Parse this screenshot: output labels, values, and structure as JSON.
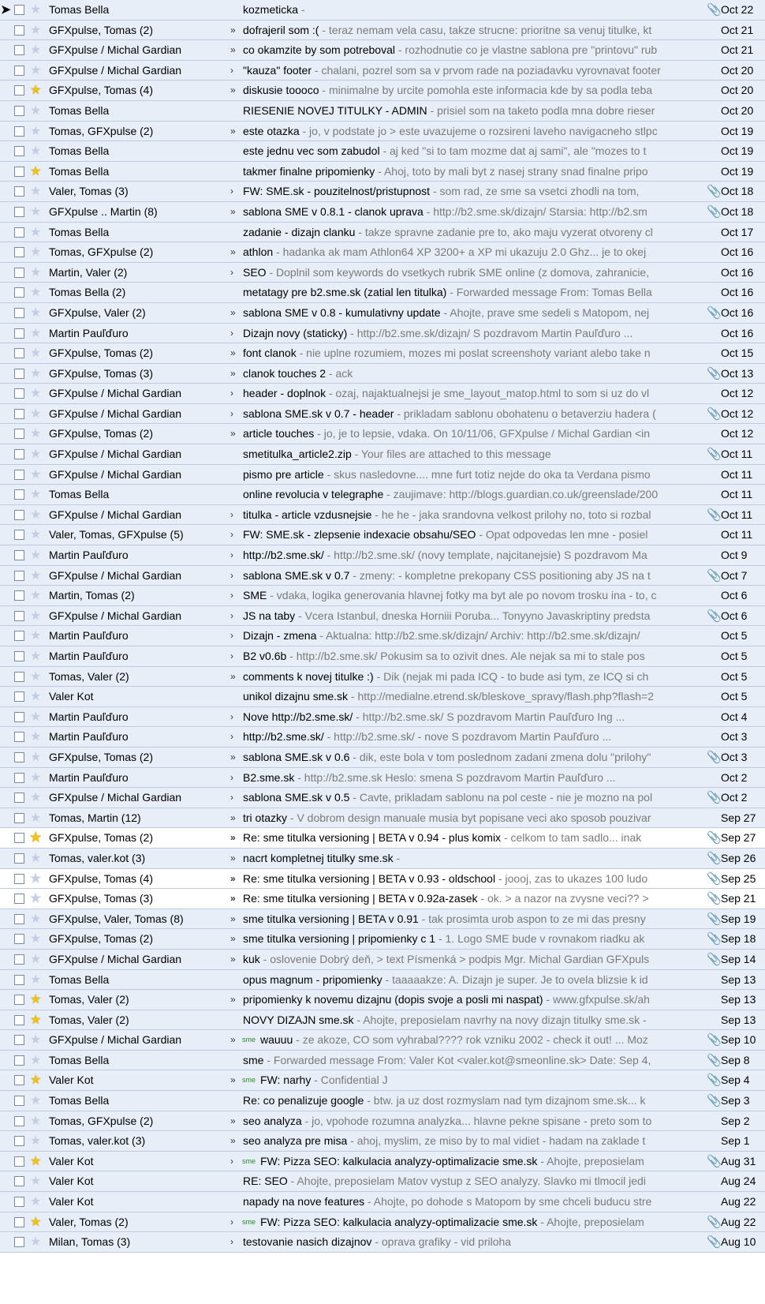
{
  "emails": [
    {
      "sender": "Tomas Bella",
      "subject": "kozmeticka",
      "snippet": " - ",
      "date": "Oct 22",
      "starred": false,
      "attachment": true,
      "imp": "",
      "pointer": true
    },
    {
      "sender": "GFXpulse, Tomas (2)",
      "subject": "dofrajeril som :(",
      "snippet": " - teraz nemam vela casu, takze strucne: prioritne sa venuj titulke, kt",
      "date": "Oct 21",
      "starred": false,
      "attachment": false,
      "imp": "»"
    },
    {
      "sender": "GFXpulse / Michal Gardian",
      "subject": "co okamzite by som potreboval",
      "snippet": " - rozhodnutie co je vlastne sablona pre \"printovu\" rub",
      "date": "Oct 21",
      "starred": false,
      "attachment": false,
      "imp": "»"
    },
    {
      "sender": "GFXpulse / Michal Gardian",
      "subject": "\"kauza\" footer",
      "snippet": " - chalani, pozrel som sa v prvom rade na poziadavku vyrovnavat footer",
      "date": "Oct 20",
      "starred": false,
      "attachment": false,
      "imp": "›"
    },
    {
      "sender": "GFXpulse, Tomas (4)",
      "subject": "diskusie toooco",
      "snippet": " - minimalne by urcite pomohla este informacia kde by sa podla teba",
      "date": "Oct 20",
      "starred": true,
      "attachment": false,
      "imp": "»"
    },
    {
      "sender": "Tomas Bella",
      "subject": "RIESENIE NOVEJ TITULKY - ADMIN",
      "snippet": " - prisiel som na taketo podla mna dobre rieser",
      "date": "Oct 20",
      "starred": false,
      "attachment": false,
      "imp": ""
    },
    {
      "sender": "Tomas, GFXpulse (2)",
      "subject": "este otazka",
      "snippet": " - jo, v podstate jo > este uvazujeme o rozsireni laveho navigacneho stlpc",
      "date": "Oct 19",
      "starred": false,
      "attachment": false,
      "imp": "»"
    },
    {
      "sender": "Tomas Bella",
      "subject": "este jednu vec som zabudol",
      "snippet": " - aj ked \"si to tam mozme dat aj sami\", ale \"mozes to t",
      "date": "Oct 19",
      "starred": false,
      "attachment": false,
      "imp": ""
    },
    {
      "sender": "Tomas Bella",
      "subject": "takmer finalne pripomienky",
      "snippet": " - Ahoj, toto by mali byt z nasej strany snad finalne pripo",
      "date": "Oct 19",
      "starred": true,
      "attachment": false,
      "imp": ""
    },
    {
      "sender": "Valer, Tomas (3)",
      "subject": "FW: SME.sk - pouzitelnost/pristupnost",
      "snippet": " - som rad, ze sme sa vsetci zhodli na tom,",
      "date": "Oct 18",
      "starred": false,
      "attachment": true,
      "imp": "›"
    },
    {
      "sender": "GFXpulse .. Martin (8)",
      "subject": "sablona SME v 0.8.1 - clanok uprava",
      "snippet": " - http://b2.sme.sk/dizajn/ Starsia: http://b2.sm",
      "date": "Oct 18",
      "starred": false,
      "attachment": true,
      "imp": "»"
    },
    {
      "sender": "Tomas Bella",
      "subject": "zadanie - dizajn clanku",
      "snippet": " - takze spravne zadanie pre to, ako maju vyzerat otvoreny cl",
      "date": "Oct 17",
      "starred": false,
      "attachment": false,
      "imp": ""
    },
    {
      "sender": "Tomas, GFXpulse (2)",
      "subject": "athlon",
      "snippet": " - hadanka ak mam Athlon64 XP 3200+ a XP mi ukazuju 2.0 Ghz... je to okej",
      "date": "Oct 16",
      "starred": false,
      "attachment": false,
      "imp": "»"
    },
    {
      "sender": "Martin, Valer (2)",
      "subject": "SEO",
      "snippet": " - Doplnil som keywords do vsetkych rubrik SME online (z domova, zahranicie,",
      "date": "Oct 16",
      "starred": false,
      "attachment": false,
      "imp": "›"
    },
    {
      "sender": "Tomas Bella (2)",
      "subject": "metatagy pre b2.sme.sk (zatial len titulka)",
      "snippet": " - Forwarded message From: Tomas Bella",
      "date": "Oct 16",
      "starred": false,
      "attachment": false,
      "imp": ""
    },
    {
      "sender": "GFXpulse, Valer (2)",
      "subject": "sablona SME v 0.8 - kumulativny update",
      "snippet": " - Ahojte, prave sme sedeli s Matopom, nej",
      "date": "Oct 16",
      "starred": false,
      "attachment": true,
      "imp": "»"
    },
    {
      "sender": "Martin Pauľďuro",
      "subject": "Dizajn novy (staticky)",
      "snippet": " - http://b2.sme.sk/dizajn/ S pozdravom Martin Pauľďuro ...",
      "date": "Oct 16",
      "starred": false,
      "attachment": false,
      "imp": "›"
    },
    {
      "sender": "GFXpulse, Tomas (2)",
      "subject": "font clanok",
      "snippet": " - nie uplne rozumiem, mozes mi poslat screenshoty variant alebo take n",
      "date": "Oct 15",
      "starred": false,
      "attachment": false,
      "imp": "»"
    },
    {
      "sender": "GFXpulse, Tomas (3)",
      "subject": "clanok touches 2",
      "snippet": " - ack",
      "date": "Oct 13",
      "starred": false,
      "attachment": true,
      "imp": "»"
    },
    {
      "sender": "GFXpulse / Michal Gardian",
      "subject": "header - doplnok",
      "snippet": " - ozaj, najaktualnejsi je sme_layout_matop.html to som si uz do vl",
      "date": "Oct 12",
      "starred": false,
      "attachment": false,
      "imp": "›"
    },
    {
      "sender": "GFXpulse / Michal Gardian",
      "subject": "sablona SME.sk v 0.7 - header",
      "snippet": " - prikladam sablonu obohatenu o betaverziu hadera (",
      "date": "Oct 12",
      "starred": false,
      "attachment": true,
      "imp": "›"
    },
    {
      "sender": "GFXpulse, Tomas (2)",
      "subject": "article touches",
      "snippet": " - jo, je to lepsie, vdaka. On 10/11/06, GFXpulse / Michal Gardian <in",
      "date": "Oct 12",
      "starred": false,
      "attachment": false,
      "imp": "»"
    },
    {
      "sender": "GFXpulse / Michal Gardian",
      "subject": "smetitulka_article2.zip",
      "snippet": " - Your files are attached to this message",
      "date": "Oct 11",
      "starred": false,
      "attachment": true,
      "imp": ""
    },
    {
      "sender": "GFXpulse / Michal Gardian",
      "subject": "pismo pre article",
      "snippet": " - skus nasledovne.... mne furt totiz nejde do oka ta Verdana pismo",
      "date": "Oct 11",
      "starred": false,
      "attachment": false,
      "imp": ""
    },
    {
      "sender": "Tomas Bella",
      "subject": "online revolucia v telegraphe",
      "snippet": " - zaujimave: http://blogs.guardian.co.uk/greenslade/200",
      "date": "Oct 11",
      "starred": false,
      "attachment": false,
      "imp": ""
    },
    {
      "sender": "GFXpulse / Michal Gardian",
      "subject": "titulka - article vzdusnejsie",
      "snippet": " - he he - jaka srandovna velkost prilohy no, toto si rozbal",
      "date": "Oct 11",
      "starred": false,
      "attachment": true,
      "imp": "›"
    },
    {
      "sender": "Valer, Tomas, GFXpulse (5)",
      "subject": "FW: SME.sk - zlepsenie indexacie obsahu/SEO",
      "snippet": " - Opat odpovedas len mne - posiel",
      "date": "Oct 11",
      "starred": false,
      "attachment": false,
      "imp": "›"
    },
    {
      "sender": "Martin Pauľďuro",
      "subject": "http://b2.sme.sk/",
      "snippet": " - http://b2.sme.sk/ (novy template, najcitanejsie) S pozdravom Ma",
      "date": "Oct 9",
      "starred": false,
      "attachment": false,
      "imp": "›"
    },
    {
      "sender": "GFXpulse / Michal Gardian",
      "subject": "sablona SME.sk v 0.7",
      "snippet": " - zmeny: - kompletne prekopany CSS positioning aby JS na t",
      "date": "Oct 7",
      "starred": false,
      "attachment": true,
      "imp": "›"
    },
    {
      "sender": "Martin, Tomas (2)",
      "subject": "SME",
      "snippet": " - vdaka, logika generovania hlavnej fotky ma byt ale po novom trosku ina - to, c",
      "date": "Oct 6",
      "starred": false,
      "attachment": false,
      "imp": "›"
    },
    {
      "sender": "GFXpulse / Michal Gardian",
      "subject": "JS na taby",
      "snippet": " - Vcera Istanbul, dneska Horniii Poruba... Tonyyno Javaskriptiny predsta",
      "date": "Oct 6",
      "starred": false,
      "attachment": true,
      "imp": "›"
    },
    {
      "sender": "Martin Pauľďuro",
      "subject": "Dizajn - zmena",
      "snippet": " - Aktualna: http://b2.sme.sk/dizajn/ Archiv: http://b2.sme.sk/dizajn/",
      "date": "Oct 5",
      "starred": false,
      "attachment": false,
      "imp": "›"
    },
    {
      "sender": "Martin Pauľďuro",
      "subject": "B2 v0.6b",
      "snippet": " - http://b2.sme.sk/ Pokusim sa to ozivit dnes. Ale nejak sa mi to stale pos",
      "date": "Oct 5",
      "starred": false,
      "attachment": false,
      "imp": "›"
    },
    {
      "sender": "Tomas, Valer (2)",
      "subject": "comments k novej titulke :)",
      "snippet": " - Dik (nejak mi pada ICQ - to bude asi tym, ze ICQ si ch",
      "date": "Oct 5",
      "starred": false,
      "attachment": false,
      "imp": "»"
    },
    {
      "sender": "Valer Kot",
      "subject": "unikol dizajnu sme.sk",
      "snippet": " - http://medialne.etrend.sk/bleskove_spravy/flash.php?flash=2",
      "date": "Oct 5",
      "starred": false,
      "attachment": false,
      "imp": ""
    },
    {
      "sender": "Martin Pauľďuro",
      "subject": "Nove http://b2.sme.sk/",
      "snippet": " - http://b2.sme.sk/ S pozdravom Martin Pauľďuro Ing ...",
      "date": "Oct 4",
      "starred": false,
      "attachment": false,
      "imp": "›"
    },
    {
      "sender": "Martin Pauľďuro",
      "subject": "http://b2.sme.sk/",
      "snippet": " - http://b2.sme.sk/ - nove S pozdravom Martin Pauľďuro ...",
      "date": "Oct 3",
      "starred": false,
      "attachment": false,
      "imp": "›"
    },
    {
      "sender": "GFXpulse, Tomas (2)",
      "subject": "sablona SME.sk v 0.6",
      "snippet": " - dik, este bola v tom poslednom zadani zmena dolu \"prilohy\"",
      "date": "Oct 3",
      "starred": false,
      "attachment": true,
      "imp": "»"
    },
    {
      "sender": "Martin Pauľďuro",
      "subject": "B2.sme.sk",
      "snippet": " - http://b2.sme.sk Heslo: smena S pozdravom Martin Pauľďuro ...",
      "date": "Oct 2",
      "starred": false,
      "attachment": false,
      "imp": "›"
    },
    {
      "sender": "GFXpulse / Michal Gardian",
      "subject": "sablona SME.sk v 0.5",
      "snippet": " - Cavte, prikladam sablonu na pol ceste - nie je mozno na pol",
      "date": "Oct 2",
      "starred": false,
      "attachment": true,
      "imp": "›"
    },
    {
      "sender": "Tomas, Martin (12)",
      "subject": "tri otazky",
      "snippet": " - V dobrom design manuale musia byt popisane veci ako sposob pouzivar",
      "date": "Sep 27",
      "starred": false,
      "attachment": false,
      "imp": "»"
    },
    {
      "sender": "GFXpulse, Tomas (2)",
      "subject": "Re: sme titulka versioning | BETA v 0.94 - plus komix",
      "snippet": " - celkom to tam sadlo... inak",
      "date": "Sep 27",
      "starred": true,
      "attachment": true,
      "imp": "»",
      "unread": true
    },
    {
      "sender": "Tomas, valer.kot (3)",
      "subject": "nacrt kompletnej titulky sme.sk",
      "snippet": " - ",
      "date": "Sep 26",
      "starred": false,
      "attachment": true,
      "imp": "»"
    },
    {
      "sender": "GFXpulse, Tomas (4)",
      "subject": "Re: sme titulka versioning | BETA v 0.93 - oldschool",
      "snippet": " - joooj, zas to ukazes 100 ludo",
      "date": "Sep 25",
      "starred": false,
      "attachment": true,
      "imp": "»",
      "unread": true
    },
    {
      "sender": "GFXpulse, Tomas (3)",
      "subject": "Re: sme titulka versioning | BETA v 0.92a-zasek",
      "snippet": " - ok. > a nazor na zvysne veci?? >",
      "date": "Sep 21",
      "starred": false,
      "attachment": true,
      "imp": "»",
      "unread": true
    },
    {
      "sender": "GFXpulse, Valer, Tomas (8)",
      "subject": "sme titulka versioning | BETA v 0.91",
      "snippet": " - tak prosimta urob aspon to ze mi das presny",
      "date": "Sep 19",
      "starred": false,
      "attachment": true,
      "imp": "»"
    },
    {
      "sender": "GFXpulse, Tomas (2)",
      "subject": "sme titulka versioning | pripomienky c 1",
      "snippet": " - 1. Logo SME bude v rovnakom riadku ak",
      "date": "Sep 18",
      "starred": false,
      "attachment": true,
      "imp": "»"
    },
    {
      "sender": "GFXpulse / Michal Gardian",
      "subject": "kuk",
      "snippet": " - oslovenie Dobrý deň, > text Písmenká > podpis Mgr. Michal Gardian GFXpuls",
      "date": "Sep 14",
      "starred": false,
      "attachment": true,
      "imp": "»"
    },
    {
      "sender": "Tomas Bella",
      "subject": "opus magnum - pripomienky",
      "snippet": " - taaaaakze: A. Dizajn je super. Je to ovela blizsie k id",
      "date": "Sep 13",
      "starred": false,
      "attachment": false,
      "imp": ""
    },
    {
      "sender": "Tomas, Valer (2)",
      "subject": "pripomienky k novemu dizajnu (dopis svoje a posli mi naspat)",
      "snippet": " - www.gfxpulse.sk/ah",
      "date": "Sep 13",
      "starred": true,
      "attachment": false,
      "imp": "»"
    },
    {
      "sender": "Tomas, Valer (2)",
      "subject": "NOVY DIZAJN sme.sk",
      "snippet": " - Ahojte, preposielam navrhy na novy dizajn titulky sme.sk -",
      "date": "Sep 13",
      "starred": true,
      "attachment": false,
      "imp": ""
    },
    {
      "sender": "GFXpulse / Michal Gardian",
      "subject": "wauuu",
      "snippet": " - ze akoze, CO som vyhrabal???? rok vzniku 2002 - check it out! ... Moz",
      "date": "Sep 10",
      "starred": false,
      "attachment": true,
      "imp": "»",
      "label": "sme"
    },
    {
      "sender": "Tomas Bella",
      "subject": "sme",
      "snippet": " - Forwarded message From: Valer Kot <valer.kot@smeonline.sk> Date: Sep 4,",
      "date": "Sep 8",
      "starred": false,
      "attachment": true,
      "imp": ""
    },
    {
      "sender": "Valer Kot",
      "subject": "FW: narhy",
      "snippet": " - Confidential J",
      "date": "Sep 4",
      "starred": true,
      "attachment": true,
      "imp": "»",
      "label": "sme"
    },
    {
      "sender": "Tomas Bella",
      "subject": "Re: co penalizuje google",
      "snippet": " - btw. ja uz dost rozmyslam nad tym dizajnom sme.sk... k",
      "date": "Sep 3",
      "starred": false,
      "attachment": true,
      "imp": ""
    },
    {
      "sender": "Tomas, GFXpulse (2)",
      "subject": "seo analyza",
      "snippet": " - jo, vpohode rozumna analyzka... hlavne pekne spisane - preto som to",
      "date": "Sep 2",
      "starred": false,
      "attachment": false,
      "imp": "»"
    },
    {
      "sender": "Tomas, valer.kot (3)",
      "subject": "seo analyza pre misa",
      "snippet": " - ahoj, myslim, ze miso by to mal vidiet - hadam na zaklade t",
      "date": "Sep 1",
      "starred": false,
      "attachment": false,
      "imp": "»"
    },
    {
      "sender": "Valer Kot",
      "subject": "FW: Pizza SEO: kalkulacia analyzy-optimalizacie sme.sk",
      "snippet": " - Ahojte, preposielam",
      "date": "Aug 31",
      "starred": true,
      "attachment": true,
      "imp": "›",
      "label": "sme"
    },
    {
      "sender": "Valer Kot",
      "subject": "RE: SEO",
      "snippet": " - Ahojte, preposielam Matov vystup z SEO analyzy. Slavko mi tlmocil jedi",
      "date": "Aug 24",
      "starred": false,
      "attachment": false,
      "imp": ""
    },
    {
      "sender": "Valer Kot",
      "subject": "napady na nove features",
      "snippet": " - Ahojte, po dohode s Matopom by sme chceli buducu stre",
      "date": "Aug 22",
      "starred": false,
      "attachment": false,
      "imp": ""
    },
    {
      "sender": "Valer, Tomas (2)",
      "subject": "FW: Pizza SEO: kalkulacia analyzy-optimalizacie sme.sk",
      "snippet": " - Ahojte, preposielam",
      "date": "Aug 22",
      "starred": true,
      "attachment": true,
      "imp": "›",
      "label": "sme"
    },
    {
      "sender": "Milan, Tomas (3)",
      "subject": "testovanie nasich dizajnov",
      "snippet": " - oprava grafiky - vid priloha",
      "date": "Aug 10",
      "starred": false,
      "attachment": true,
      "imp": "›"
    }
  ]
}
